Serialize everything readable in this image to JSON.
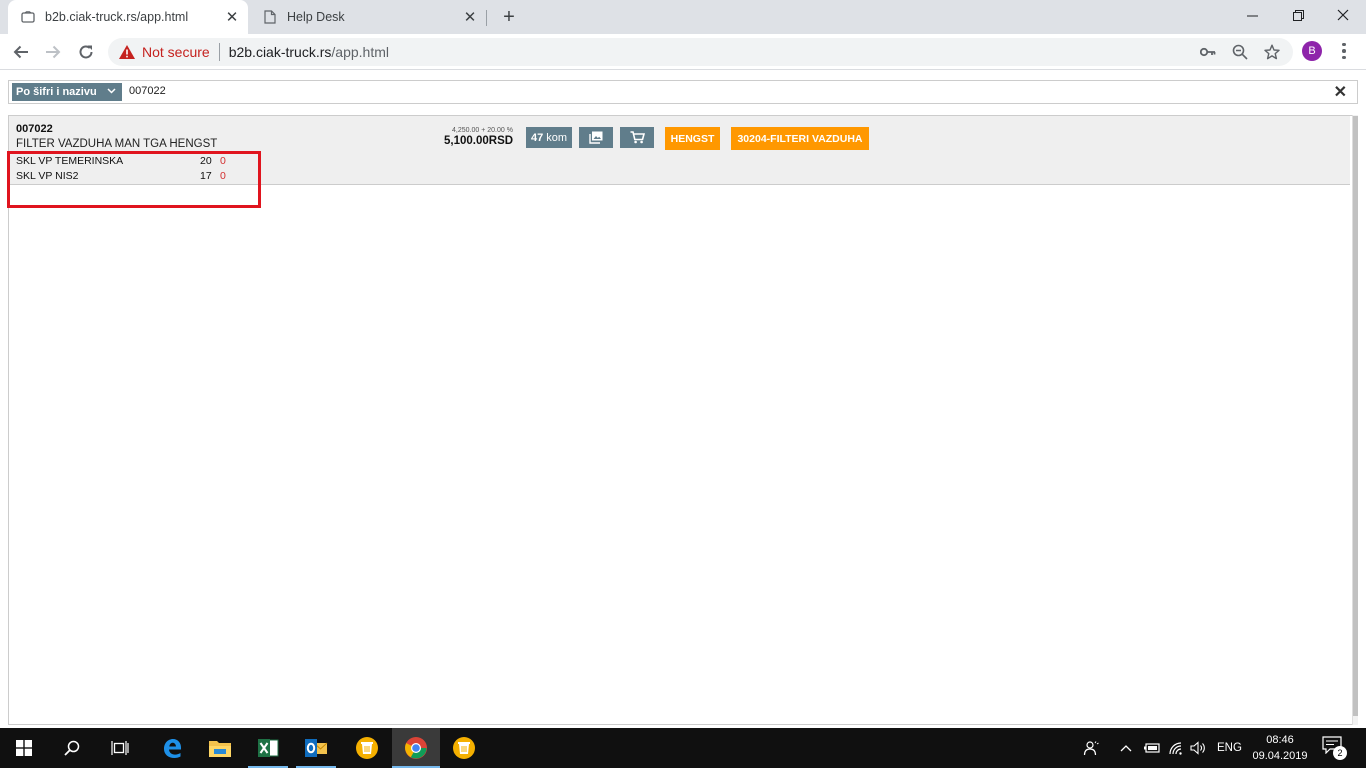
{
  "browser": {
    "tabs": [
      {
        "title": "b2b.ciak-truck.rs/app.html",
        "active": true
      },
      {
        "title": "Help Desk",
        "active": false
      }
    ],
    "omnibox": {
      "security_label": "Not secure",
      "url_host": "b2b.ciak-truck.rs",
      "url_path": "/app.html"
    },
    "profile_initial": "B"
  },
  "search": {
    "mode_label": "Po šifri i nazivu",
    "query": "007022",
    "clear_label": "✕"
  },
  "result": {
    "code": "007022",
    "name": "FILTER VAZDUHA MAN TGA HENGST",
    "stock": [
      {
        "warehouse": "SKL VP TEMERINSKA",
        "qty": "20",
        "reserved": "0"
      },
      {
        "warehouse": "SKL VP NIS2",
        "qty": "17",
        "reserved": "0"
      }
    ],
    "price_detail": "4,250.00 + 20.00 %",
    "price_total": "5,100.00RSD",
    "quantity_value": "47",
    "quantity_unit": "kom",
    "brand_label": "HENGST",
    "group_label": "30204-FILTERI VAZDUHA"
  },
  "taskbar": {
    "language": "ENG",
    "time": "08:46",
    "date": "09.04.2019",
    "notification_count": "2"
  },
  "colors": {
    "accent_slate": "#607d8b",
    "accent_orange": "#ff9800",
    "highlight_red": "#e0141e",
    "reserved_red": "#d32f2f"
  }
}
